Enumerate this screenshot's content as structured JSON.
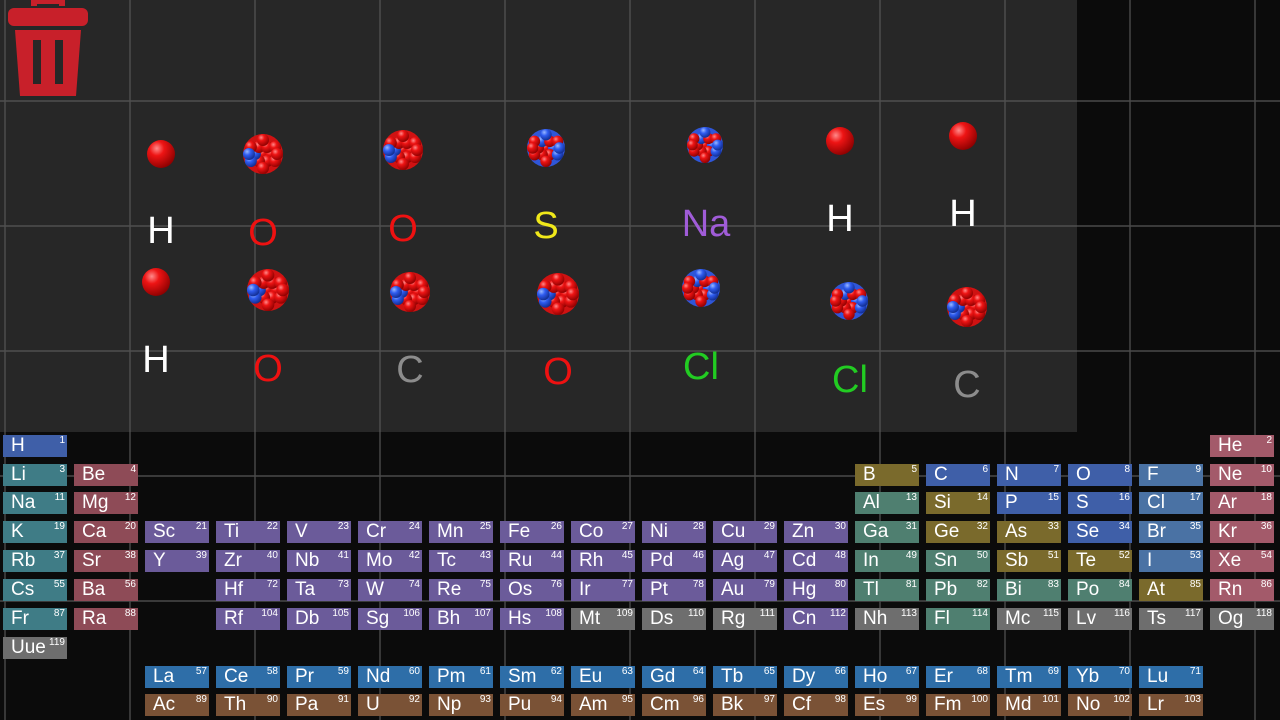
{
  "workspace": {
    "trash_icon": "trash-icon",
    "trash_color": "#c8202a",
    "atoms": [
      {
        "symbol": "H",
        "label_color": "#ffffff",
        "nucleus": "single"
      },
      {
        "symbol": "O",
        "label_color": "#ee1111",
        "nucleus": "cluster-red"
      },
      {
        "symbol": "O",
        "label_color": "#ee1111",
        "nucleus": "cluster-red"
      },
      {
        "symbol": "S",
        "label_color": "#f0e81a",
        "nucleus": "cluster-mixed"
      },
      {
        "symbol": "Na",
        "label_color": "#a05cd8",
        "nucleus": "cluster-mixed"
      },
      {
        "symbol": "H",
        "label_color": "#ffffff",
        "nucleus": "single"
      },
      {
        "symbol": "H",
        "label_color": "#ffffff",
        "nucleus": "single"
      },
      {
        "symbol": "H",
        "label_color": "#ffffff",
        "nucleus": "single"
      },
      {
        "symbol": "O",
        "label_color": "#ee1111",
        "nucleus": "cluster-red"
      },
      {
        "symbol": "C",
        "label_color": "#8c8c8c",
        "nucleus": "cluster-red"
      },
      {
        "symbol": "O",
        "label_color": "#ee1111",
        "nucleus": "cluster-red"
      },
      {
        "symbol": "Cl",
        "label_color": "#22cc22",
        "nucleus": "cluster-mixed"
      },
      {
        "symbol": "Cl",
        "label_color": "#22cc22",
        "nucleus": "cluster-mixed"
      },
      {
        "symbol": "C",
        "label_color": "#8c8c8c",
        "nucleus": "cluster-red"
      }
    ]
  },
  "category_colors": {
    "nonmetal": "#3f5fa8",
    "alkali": "#3f7c86",
    "alkaline": "#8e4b57",
    "transition": "#6b5b9a",
    "post_transition": "#4f7f70",
    "metalloid": "#7a6a2c",
    "halogen": "#4a72a4",
    "noble": "#a35a6a",
    "lanthanide": "#2e6ea8",
    "actinide": "#7a5236",
    "unknown": "#6e6e6e"
  },
  "periodic_table": {
    "elements": [
      {
        "s": "H",
        "n": "1",
        "cat": "nonmetal"
      },
      {
        "s": "He",
        "n": "2",
        "cat": "noble"
      },
      {
        "s": "Li",
        "n": "3",
        "cat": "alkali"
      },
      {
        "s": "Be",
        "n": "4",
        "cat": "alkaline"
      },
      {
        "s": "B",
        "n": "5",
        "cat": "metalloid"
      },
      {
        "s": "C",
        "n": "6",
        "cat": "nonmetal"
      },
      {
        "s": "N",
        "n": "7",
        "cat": "nonmetal"
      },
      {
        "s": "O",
        "n": "8",
        "cat": "nonmetal"
      },
      {
        "s": "F",
        "n": "9",
        "cat": "halogen"
      },
      {
        "s": "Ne",
        "n": "10",
        "cat": "noble"
      },
      {
        "s": "Na",
        "n": "11",
        "cat": "alkali"
      },
      {
        "s": "Mg",
        "n": "12",
        "cat": "alkaline"
      },
      {
        "s": "Al",
        "n": "13",
        "cat": "post_transition"
      },
      {
        "s": "Si",
        "n": "14",
        "cat": "metalloid"
      },
      {
        "s": "P",
        "n": "15",
        "cat": "nonmetal"
      },
      {
        "s": "S",
        "n": "16",
        "cat": "nonmetal"
      },
      {
        "s": "Cl",
        "n": "17",
        "cat": "halogen"
      },
      {
        "s": "Ar",
        "n": "18",
        "cat": "noble"
      },
      {
        "s": "K",
        "n": "19",
        "cat": "alkali"
      },
      {
        "s": "Ca",
        "n": "20",
        "cat": "alkaline"
      },
      {
        "s": "Sc",
        "n": "21",
        "cat": "transition"
      },
      {
        "s": "Ti",
        "n": "22",
        "cat": "transition"
      },
      {
        "s": "V",
        "n": "23",
        "cat": "transition"
      },
      {
        "s": "Cr",
        "n": "24",
        "cat": "transition"
      },
      {
        "s": "Mn",
        "n": "25",
        "cat": "transition"
      },
      {
        "s": "Fe",
        "n": "26",
        "cat": "transition"
      },
      {
        "s": "Co",
        "n": "27",
        "cat": "transition"
      },
      {
        "s": "Ni",
        "n": "28",
        "cat": "transition"
      },
      {
        "s": "Cu",
        "n": "29",
        "cat": "transition"
      },
      {
        "s": "Zn",
        "n": "30",
        "cat": "transition"
      },
      {
        "s": "Ga",
        "n": "31",
        "cat": "post_transition"
      },
      {
        "s": "Ge",
        "n": "32",
        "cat": "metalloid"
      },
      {
        "s": "As",
        "n": "33",
        "cat": "metalloid"
      },
      {
        "s": "Se",
        "n": "34",
        "cat": "nonmetal"
      },
      {
        "s": "Br",
        "n": "35",
        "cat": "halogen"
      },
      {
        "s": "Kr",
        "n": "36",
        "cat": "noble"
      },
      {
        "s": "Rb",
        "n": "37",
        "cat": "alkali"
      },
      {
        "s": "Sr",
        "n": "38",
        "cat": "alkaline"
      },
      {
        "s": "Y",
        "n": "39",
        "cat": "transition"
      },
      {
        "s": "Zr",
        "n": "40",
        "cat": "transition"
      },
      {
        "s": "Nb",
        "n": "41",
        "cat": "transition"
      },
      {
        "s": "Mo",
        "n": "42",
        "cat": "transition"
      },
      {
        "s": "Tc",
        "n": "43",
        "cat": "transition"
      },
      {
        "s": "Ru",
        "n": "44",
        "cat": "transition"
      },
      {
        "s": "Rh",
        "n": "45",
        "cat": "transition"
      },
      {
        "s": "Pd",
        "n": "46",
        "cat": "transition"
      },
      {
        "s": "Ag",
        "n": "47",
        "cat": "transition"
      },
      {
        "s": "Cd",
        "n": "48",
        "cat": "transition"
      },
      {
        "s": "In",
        "n": "49",
        "cat": "post_transition"
      },
      {
        "s": "Sn",
        "n": "50",
        "cat": "post_transition"
      },
      {
        "s": "Sb",
        "n": "51",
        "cat": "metalloid"
      },
      {
        "s": "Te",
        "n": "52",
        "cat": "metalloid"
      },
      {
        "s": "I",
        "n": "53",
        "cat": "halogen"
      },
      {
        "s": "Xe",
        "n": "54",
        "cat": "noble"
      },
      {
        "s": "Cs",
        "n": "55",
        "cat": "alkali"
      },
      {
        "s": "Ba",
        "n": "56",
        "cat": "alkaline"
      },
      {
        "s": "Hf",
        "n": "72",
        "cat": "transition"
      },
      {
        "s": "Ta",
        "n": "73",
        "cat": "transition"
      },
      {
        "s": "W",
        "n": "74",
        "cat": "transition"
      },
      {
        "s": "Re",
        "n": "75",
        "cat": "transition"
      },
      {
        "s": "Os",
        "n": "76",
        "cat": "transition"
      },
      {
        "s": "Ir",
        "n": "77",
        "cat": "transition"
      },
      {
        "s": "Pt",
        "n": "78",
        "cat": "transition"
      },
      {
        "s": "Au",
        "n": "79",
        "cat": "transition"
      },
      {
        "s": "Hg",
        "n": "80",
        "cat": "transition"
      },
      {
        "s": "Tl",
        "n": "81",
        "cat": "post_transition"
      },
      {
        "s": "Pb",
        "n": "82",
        "cat": "post_transition"
      },
      {
        "s": "Bi",
        "n": "83",
        "cat": "post_transition"
      },
      {
        "s": "Po",
        "n": "84",
        "cat": "post_transition"
      },
      {
        "s": "At",
        "n": "85",
        "cat": "metalloid"
      },
      {
        "s": "Rn",
        "n": "86",
        "cat": "noble"
      },
      {
        "s": "Fr",
        "n": "87",
        "cat": "alkali"
      },
      {
        "s": "Ra",
        "n": "88",
        "cat": "alkaline"
      },
      {
        "s": "Rf",
        "n": "104",
        "cat": "transition"
      },
      {
        "s": "Db",
        "n": "105",
        "cat": "transition"
      },
      {
        "s": "Sg",
        "n": "106",
        "cat": "transition"
      },
      {
        "s": "Bh",
        "n": "107",
        "cat": "transition"
      },
      {
        "s": "Hs",
        "n": "108",
        "cat": "transition"
      },
      {
        "s": "Mt",
        "n": "109",
        "cat": "unknown"
      },
      {
        "s": "Ds",
        "n": "110",
        "cat": "unknown"
      },
      {
        "s": "Rg",
        "n": "111",
        "cat": "unknown"
      },
      {
        "s": "Cn",
        "n": "112",
        "cat": "transition"
      },
      {
        "s": "Nh",
        "n": "113",
        "cat": "unknown"
      },
      {
        "s": "Fl",
        "n": "114",
        "cat": "post_transition"
      },
      {
        "s": "Mc",
        "n": "115",
        "cat": "unknown"
      },
      {
        "s": "Lv",
        "n": "116",
        "cat": "unknown"
      },
      {
        "s": "Ts",
        "n": "117",
        "cat": "unknown"
      },
      {
        "s": "Og",
        "n": "118",
        "cat": "unknown"
      },
      {
        "s": "Uue",
        "n": "119",
        "cat": "unknown"
      },
      {
        "s": "La",
        "n": "57",
        "cat": "lanthanide"
      },
      {
        "s": "Ce",
        "n": "58",
        "cat": "lanthanide"
      },
      {
        "s": "Pr",
        "n": "59",
        "cat": "lanthanide"
      },
      {
        "s": "Nd",
        "n": "60",
        "cat": "lanthanide"
      },
      {
        "s": "Pm",
        "n": "61",
        "cat": "lanthanide"
      },
      {
        "s": "Sm",
        "n": "62",
        "cat": "lanthanide"
      },
      {
        "s": "Eu",
        "n": "63",
        "cat": "lanthanide"
      },
      {
        "s": "Gd",
        "n": "64",
        "cat": "lanthanide"
      },
      {
        "s": "Tb",
        "n": "65",
        "cat": "lanthanide"
      },
      {
        "s": "Dy",
        "n": "66",
        "cat": "lanthanide"
      },
      {
        "s": "Ho",
        "n": "67",
        "cat": "lanthanide"
      },
      {
        "s": "Er",
        "n": "68",
        "cat": "lanthanide"
      },
      {
        "s": "Tm",
        "n": "69",
        "cat": "lanthanide"
      },
      {
        "s": "Yb",
        "n": "70",
        "cat": "lanthanide"
      },
      {
        "s": "Lu",
        "n": "71",
        "cat": "lanthanide"
      },
      {
        "s": "Ac",
        "n": "89",
        "cat": "actinide"
      },
      {
        "s": "Th",
        "n": "90",
        "cat": "actinide"
      },
      {
        "s": "Pa",
        "n": "91",
        "cat": "actinide"
      },
      {
        "s": "U",
        "n": "92",
        "cat": "actinide"
      },
      {
        "s": "Np",
        "n": "93",
        "cat": "actinide"
      },
      {
        "s": "Pu",
        "n": "94",
        "cat": "actinide"
      },
      {
        "s": "Am",
        "n": "95",
        "cat": "actinide"
      },
      {
        "s": "Cm",
        "n": "96",
        "cat": "actinide"
      },
      {
        "s": "Bk",
        "n": "97",
        "cat": "actinide"
      },
      {
        "s": "Cf",
        "n": "98",
        "cat": "actinide"
      },
      {
        "s": "Es",
        "n": "99",
        "cat": "actinide"
      },
      {
        "s": "Fm",
        "n": "100",
        "cat": "actinide"
      },
      {
        "s": "Md",
        "n": "101",
        "cat": "actinide"
      },
      {
        "s": "No",
        "n": "102",
        "cat": "actinide"
      },
      {
        "s": "Lr",
        "n": "103",
        "cat": "actinide"
      }
    ]
  }
}
